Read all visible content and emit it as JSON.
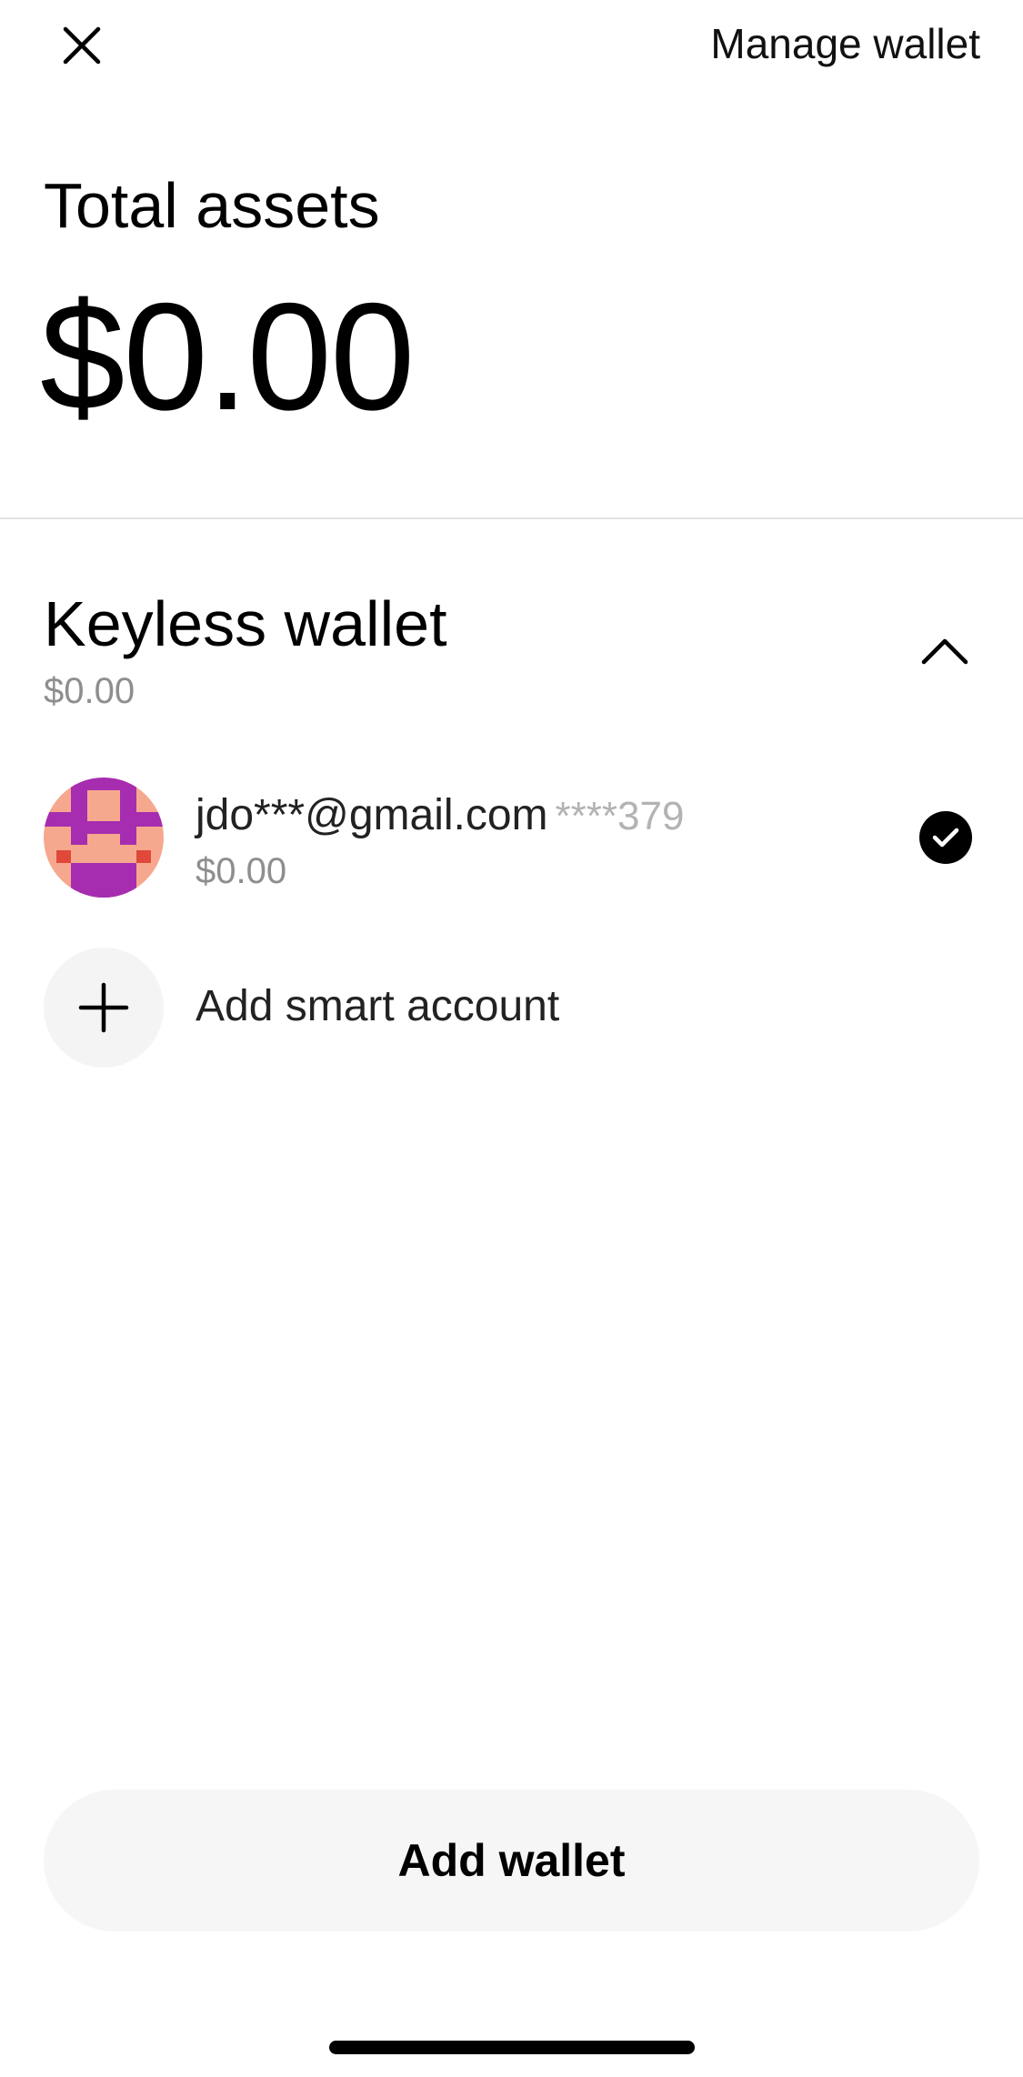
{
  "header": {
    "close_icon": "close-icon",
    "manage_label": "Manage wallet"
  },
  "summary": {
    "total_label": "Total assets",
    "total_value": "$0.00"
  },
  "wallet_group": {
    "title": "Keyless wallet",
    "balance": "$0.00",
    "expanded": true,
    "toggle_icon": "chevron-up-icon"
  },
  "accounts": [
    {
      "email": "jdo***@gmail.com",
      "address_suffix": "****379",
      "balance": "$0.00",
      "selected": true,
      "avatar_colors": [
        "#f6a88e",
        "#a62db0",
        "#e0483a"
      ]
    }
  ],
  "add_smart_account": {
    "label": "Add smart account",
    "icon": "plus-icon"
  },
  "footer": {
    "add_wallet_label": "Add wallet"
  }
}
